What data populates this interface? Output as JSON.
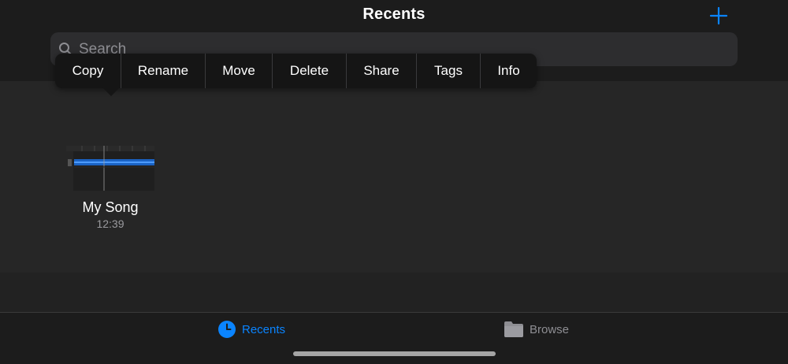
{
  "header": {
    "title": "Recents",
    "add_icon": "plus-icon"
  },
  "search": {
    "placeholder": "Search",
    "icon": "search-icon"
  },
  "context_menu": {
    "items": [
      {
        "label": "Copy"
      },
      {
        "label": "Rename"
      },
      {
        "label": "Move"
      },
      {
        "label": "Delete"
      },
      {
        "label": "Share"
      },
      {
        "label": "Tags"
      },
      {
        "label": "Info"
      }
    ]
  },
  "files": [
    {
      "name": "My Song",
      "time": "12:39",
      "thumbnail": "garageband-song-thumbnail"
    }
  ],
  "tab_bar": {
    "tabs": [
      {
        "label": "Recents",
        "icon": "clock-icon",
        "active": true
      },
      {
        "label": "Browse",
        "icon": "folder-icon",
        "active": false
      }
    ]
  },
  "colors": {
    "accent": "#0a84ff",
    "background": "#1e1e1e",
    "content": "#262626",
    "menu": "#151515",
    "inactive": "#8e8e93"
  }
}
